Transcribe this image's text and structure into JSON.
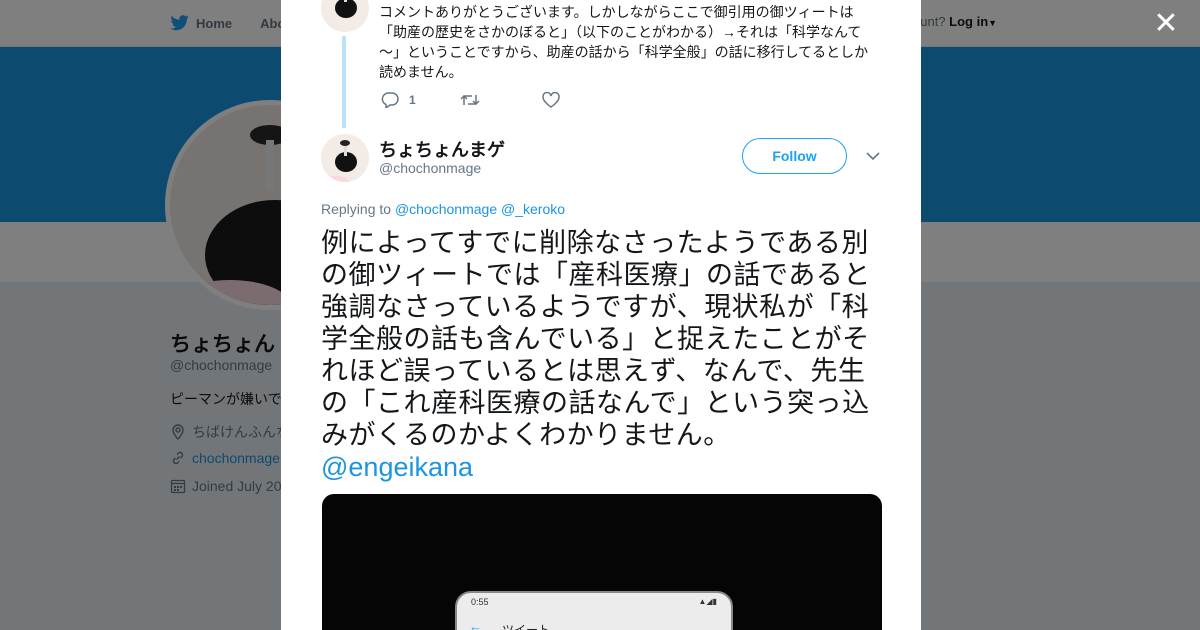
{
  "nav": {
    "home": "Home",
    "about": "Abo",
    "account_question": "ccount?",
    "login": "Log in"
  },
  "profile": {
    "name": "ちょちょん",
    "handle": "@chochonmage",
    "bio": "ピーマンが嫌いで",
    "location": "ちばけんふんな",
    "website": "chochonmage",
    "joined": "Joined July 20"
  },
  "thread": {
    "previous_text": "コメントありがとうございます。しかしながらここで御引用の御ツィートは「助産の歴史をさかのぼると」（以下のことがわかる）→それは「科学なんて～」ということですから、助産の話から「科学全般」の話に移行してるとしか読めません。",
    "reply_count": "1"
  },
  "tweet": {
    "author_name": "ちょちょんまゲ",
    "author_handle": "@chochonmage",
    "follow_label": "Follow",
    "replying_prefix": "Replying to",
    "replying_mention_1": "@chochonmage",
    "replying_mention_2": "@_keroko",
    "text": "例によってすでに削除なさったようである別の御ツィートでは「産科医療」の話であると強調なさっているようですが、現状私が「科学全般の話も含んでいる」と捉えたことがそれほど誤っているとは思えず、なんで、先生の「これ産科医療の話なんで」という突っ込みがくるのかよくわかりません。",
    "mention": "@engeikana"
  },
  "media": {
    "phone_time": "0:55",
    "phone_screen_title": "ツイート"
  },
  "colors": {
    "accent": "#1da1f2",
    "banner": "#1b95e0",
    "thread_line": "#bde1f8"
  }
}
